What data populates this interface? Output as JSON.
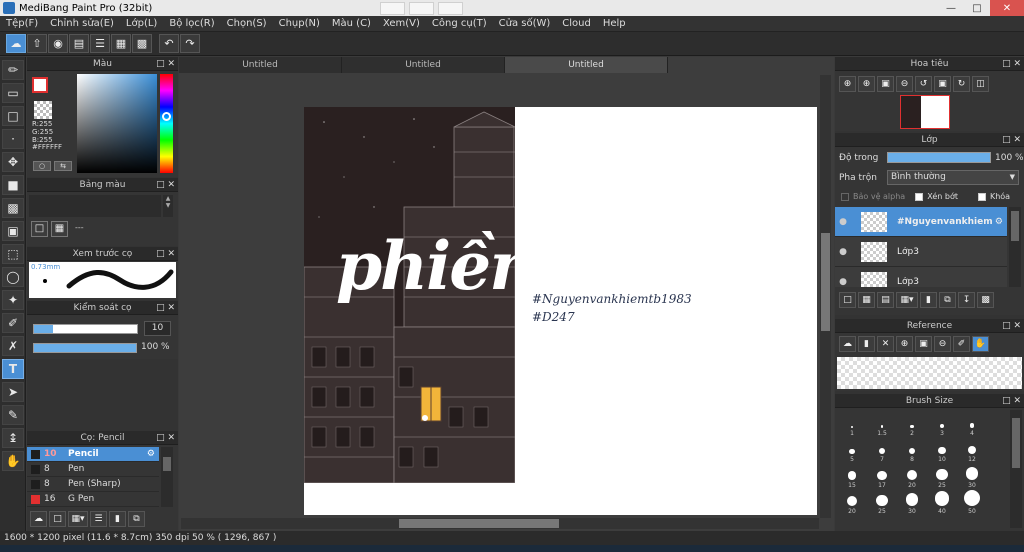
{
  "window": {
    "title": "MediBang Paint Pro (32bit)",
    "bg_tabs": [
      "",
      "",
      ""
    ]
  },
  "menu": [
    "Tệp(F)",
    "Chỉnh sửa(E)",
    "Lớp(L)",
    "Bộ lọc(R)",
    "Chọn(S)",
    "Chụp(N)",
    "Màu (C)",
    "Xem(V)",
    "Công cụ(T)",
    "Cửa số(W)",
    "Cloud",
    "Help"
  ],
  "doc_tabs": [
    "Untitled",
    "Untitled",
    "Untitled"
  ],
  "color_panel": {
    "title": "Màu",
    "rgb": "R:255\nG:255\nB:255",
    "hex": "#FFFFFF",
    "primary": "#ffffff",
    "secondary": "#ffffff"
  },
  "palette_panel": {
    "title": "Bảng màu",
    "dash": "---"
  },
  "brush_preview": {
    "title": "Xem trước cọ",
    "size": "0.73mm"
  },
  "brush_control": {
    "title": "Kiểm soát cọ",
    "size_value": "10",
    "opacity_value": "100 %"
  },
  "brush_list": {
    "title": "Cọ: Pencil",
    "items": [
      {
        "size": "10",
        "name": "Pencil",
        "active": true,
        "color": "#1e1e1e"
      },
      {
        "size": "8",
        "name": "Pen",
        "active": false,
        "color": "#1e1e1e"
      },
      {
        "size": "8",
        "name": "Pen (Sharp)",
        "active": false,
        "color": "#1e1e1e"
      },
      {
        "size": "16",
        "name": "G Pen",
        "active": false,
        "color": "#e33030"
      }
    ]
  },
  "navigator": {
    "title": "Hoa tiêu"
  },
  "layer_panel": {
    "title": "Lớp",
    "opacity_label": "Độ trong",
    "opacity_value": "100 %",
    "blend_label": "Pha trộn",
    "blend_value": "Bình thường",
    "alpha_lock": "Bảo vệ alpha",
    "clipping": "Xén bớt",
    "lock": "Khóa",
    "layers": [
      {
        "name": "#Nguyenvankhiem",
        "active": true
      },
      {
        "name": "Lớp3",
        "active": false
      },
      {
        "name": "Lớp3",
        "active": false
      }
    ]
  },
  "reference_panel": {
    "title": "Reference"
  },
  "brush_size_panel": {
    "title": "Brush Size",
    "sizes": [
      {
        "label": "1",
        "v": 1
      },
      {
        "label": "1.5",
        "v": 1.5
      },
      {
        "label": "2",
        "v": 2
      },
      {
        "label": "3",
        "v": 3
      },
      {
        "label": "4",
        "v": 4
      },
      {
        "label": "5",
        "v": 5
      },
      {
        "label": "7",
        "v": 7
      },
      {
        "label": "8",
        "v": 8
      },
      {
        "label": "10",
        "v": 10
      },
      {
        "label": "12",
        "v": 12
      },
      {
        "label": "15",
        "v": 15
      },
      {
        "label": "17",
        "v": 17
      },
      {
        "label": "20",
        "v": 20
      },
      {
        "label": "25",
        "v": 25
      },
      {
        "label": "30",
        "v": 30
      },
      {
        "label": "20",
        "v": 20
      },
      {
        "label": "25",
        "v": 25
      },
      {
        "label": "30",
        "v": 30
      },
      {
        "label": "40",
        "v": 40
      },
      {
        "label": "50",
        "v": 50
      }
    ]
  },
  "artwork": {
    "word": "phiền",
    "caption_line1": "#Nguyenvankhiemtb1983",
    "caption_line2": "#D247"
  },
  "status": "1600 * 1200 pixel  (11.6 * 8.7cm)  350 dpi  50 %  ( 1296, 867 )"
}
